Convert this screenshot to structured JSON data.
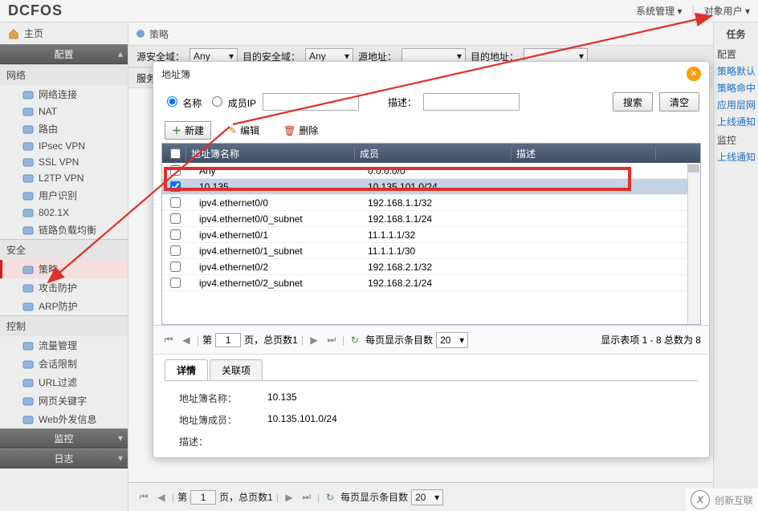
{
  "brand": "DCFOS",
  "top_menu": {
    "system": "系统管理",
    "object_user": "对象用户"
  },
  "left": {
    "home": "主页",
    "config_header": "配置",
    "group_network": "网络",
    "network_items": [
      "网络连接",
      "NAT",
      "路由",
      "IPsec VPN",
      "SSL VPN",
      "L2TP VPN",
      "用户识别",
      "802.1X",
      "链路负载均衡"
    ],
    "group_security": "安全",
    "security_items": [
      "策略",
      "攻击防护",
      "ARP防护"
    ],
    "group_control": "控制",
    "control_items": [
      "流量管理",
      "会话限制",
      "URL过滤",
      "网页关键字",
      "Web外发信息"
    ],
    "monitor_header": "监控",
    "log_header": "日志"
  },
  "center": {
    "policy_label": "策略",
    "src_zone": "源安全域：",
    "any": "Any",
    "dst_zone": "目的安全域：",
    "src_addr": "源地址：",
    "dst_addr": "目的地址：",
    "service_label": "服务",
    "pager_prefix": "第",
    "pager_page": "1",
    "pager_mid": "页，总页数1",
    "per_page_label": "每页显示条目数",
    "per_page_val": "20"
  },
  "right": {
    "header": "任务",
    "group_config": "配置",
    "links_config": [
      "策略默认导",
      "策略命中查",
      "应用层网关",
      "上线通知策"
    ],
    "group_monitor": "监控",
    "links_monitor": [
      "上线通知策"
    ]
  },
  "modal": {
    "title": "地址簿",
    "radio_name": "名称",
    "radio_member": "成员IP",
    "desc_label": "描述：",
    "btn_search": "搜索",
    "btn_clear": "清空",
    "btn_new": "新建",
    "btn_edit": "编辑",
    "btn_delete": "删除",
    "col_name": "地址簿名称",
    "col_member": "成员",
    "col_desc": "描述",
    "rows": [
      {
        "chk": false,
        "name": "Any",
        "member": "0.0.0.0/0",
        "desc": ""
      },
      {
        "chk": true,
        "name": "10.135",
        "member": "10.135.101.0/24",
        "desc": ""
      },
      {
        "chk": false,
        "name": "ipv4.ethernet0/0",
        "member": "192.168.1.1/32",
        "desc": ""
      },
      {
        "chk": false,
        "name": "ipv4.ethernet0/0_subnet",
        "member": "192.168.1.1/24",
        "desc": ""
      },
      {
        "chk": false,
        "name": "ipv4.ethernet0/1",
        "member": "11.1.1.1/32",
        "desc": ""
      },
      {
        "chk": false,
        "name": "ipv4.ethernet0/1_subnet",
        "member": "11.1.1.1/30",
        "desc": ""
      },
      {
        "chk": false,
        "name": "ipv4.ethernet0/2",
        "member": "192.168.2.1/32",
        "desc": ""
      },
      {
        "chk": false,
        "name": "ipv4.ethernet0/2_subnet",
        "member": "192.168.2.1/24",
        "desc": ""
      }
    ],
    "pager_prefix": "第",
    "pager_page": "1",
    "pager_mid": "页，总页数1",
    "per_page_label": "每页显示条目数",
    "per_page_val": "20",
    "result_text": "显示表项 1 - 8 总数为 8",
    "tab_detail": "详情",
    "tab_related": "关联项",
    "detail_name_k": "地址簿名称：",
    "detail_name_v": "10.135",
    "detail_member_k": "地址簿成员：",
    "detail_member_v": "10.135.101.0/24",
    "detail_desc_k": "描述："
  },
  "watermark": "创新互联"
}
